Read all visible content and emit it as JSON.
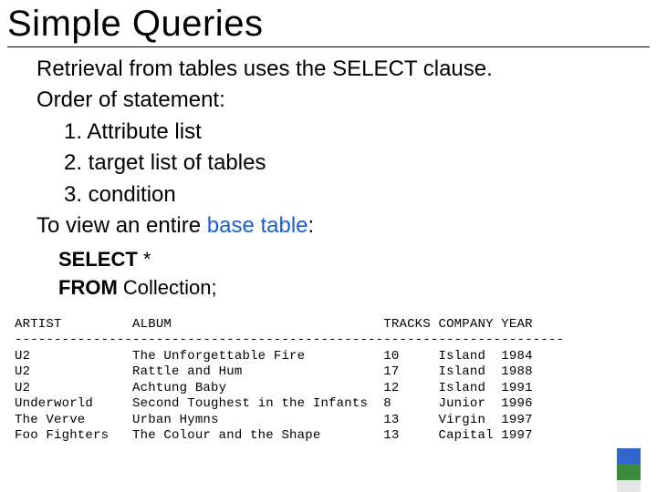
{
  "title": "Simple Queries",
  "body": {
    "line1": "Retrieval from tables uses the SELECT clause.",
    "line2": "Order of statement:",
    "items": [
      "1. Attribute list",
      "2. target list of tables",
      "3. condition"
    ],
    "line3_prefix": "To view an entire ",
    "line3_link": "base table",
    "line3_suffix": ":"
  },
  "code": {
    "kw1": "SELECT",
    "star": " *",
    "kw2": "FROM",
    "rest": " Collection;"
  },
  "result_output": "ARTIST         ALBUM                           TRACKS COMPANY YEAR\n----------------------------------------------------------------------\nU2             The Unforgettable Fire          10     Island  1984\nU2             Rattle and Hum                  17     Island  1988\nU2             Achtung Baby                    12     Island  1991\nUnderworld     Second Toughest in the Infants  8      Junior  1996\nThe Verve      Urban Hymns                     13     Virgin  1997\nFoo Fighters   The Colour and the Shape        13     Capital 1997",
  "chart_data": {
    "type": "table",
    "title": "Collection",
    "columns": [
      "ARTIST",
      "ALBUM",
      "TRACKS",
      "COMPANY",
      "YEAR"
    ],
    "rows": [
      [
        "U2",
        "The Unforgettable Fire",
        10,
        "Island",
        1984
      ],
      [
        "U2",
        "Rattle and Hum",
        17,
        "Island",
        1988
      ],
      [
        "U2",
        "Achtung Baby",
        12,
        "Island",
        1991
      ],
      [
        "Underworld",
        "Second Toughest in the Infants",
        8,
        "Junior",
        1996
      ],
      [
        "The Verve",
        "Urban Hymns",
        13,
        "Virgin",
        1997
      ],
      [
        "Foo Fighters",
        "The Colour and the Shape",
        13,
        "Capital",
        1997
      ]
    ]
  }
}
